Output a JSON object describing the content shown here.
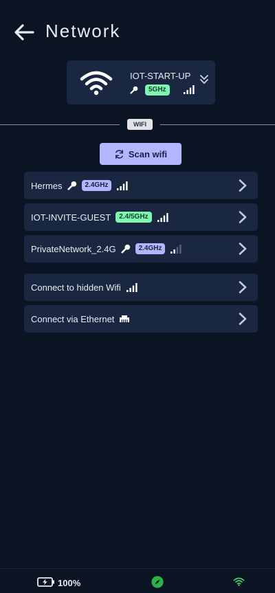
{
  "header": {
    "title": "Network",
    "back_icon": "arrow-left-icon"
  },
  "current": {
    "ssid": "IOT-START-UP",
    "band": "5GHz",
    "secured": true,
    "signal_bars": 4
  },
  "divider": {
    "label": "WIFI"
  },
  "scan": {
    "label": "Scan wifi",
    "icon": "refresh-icon"
  },
  "networks": [
    {
      "name": "Hermes",
      "secured": true,
      "band": "2.4GHz",
      "badge_color": "#b3b5ff",
      "signal_bars": 4
    },
    {
      "name": "IOT-INVITE-GUEST",
      "secured": false,
      "band": "2.4/5GHz",
      "badge_color": "#7ff5b2",
      "signal_bars": 4
    },
    {
      "name": "PrivateNetwork_2.4G",
      "secured": true,
      "band": "2.4GHz",
      "badge_color": "#b3b5ff",
      "signal_bars": 2
    }
  ],
  "extra": [
    {
      "label": "Connect to hidden Wifi",
      "icon": "signal-icon"
    },
    {
      "label": "Connect via Ethernet",
      "icon": "ethernet-icon"
    }
  ],
  "status": {
    "battery": "100%",
    "charging": true
  },
  "colors": {
    "background": "#0b1422",
    "card": "#1a2740",
    "accent": "#b3b5ff",
    "badge_green": "#7ff5b2",
    "wifi_green": "#4fd06a"
  }
}
